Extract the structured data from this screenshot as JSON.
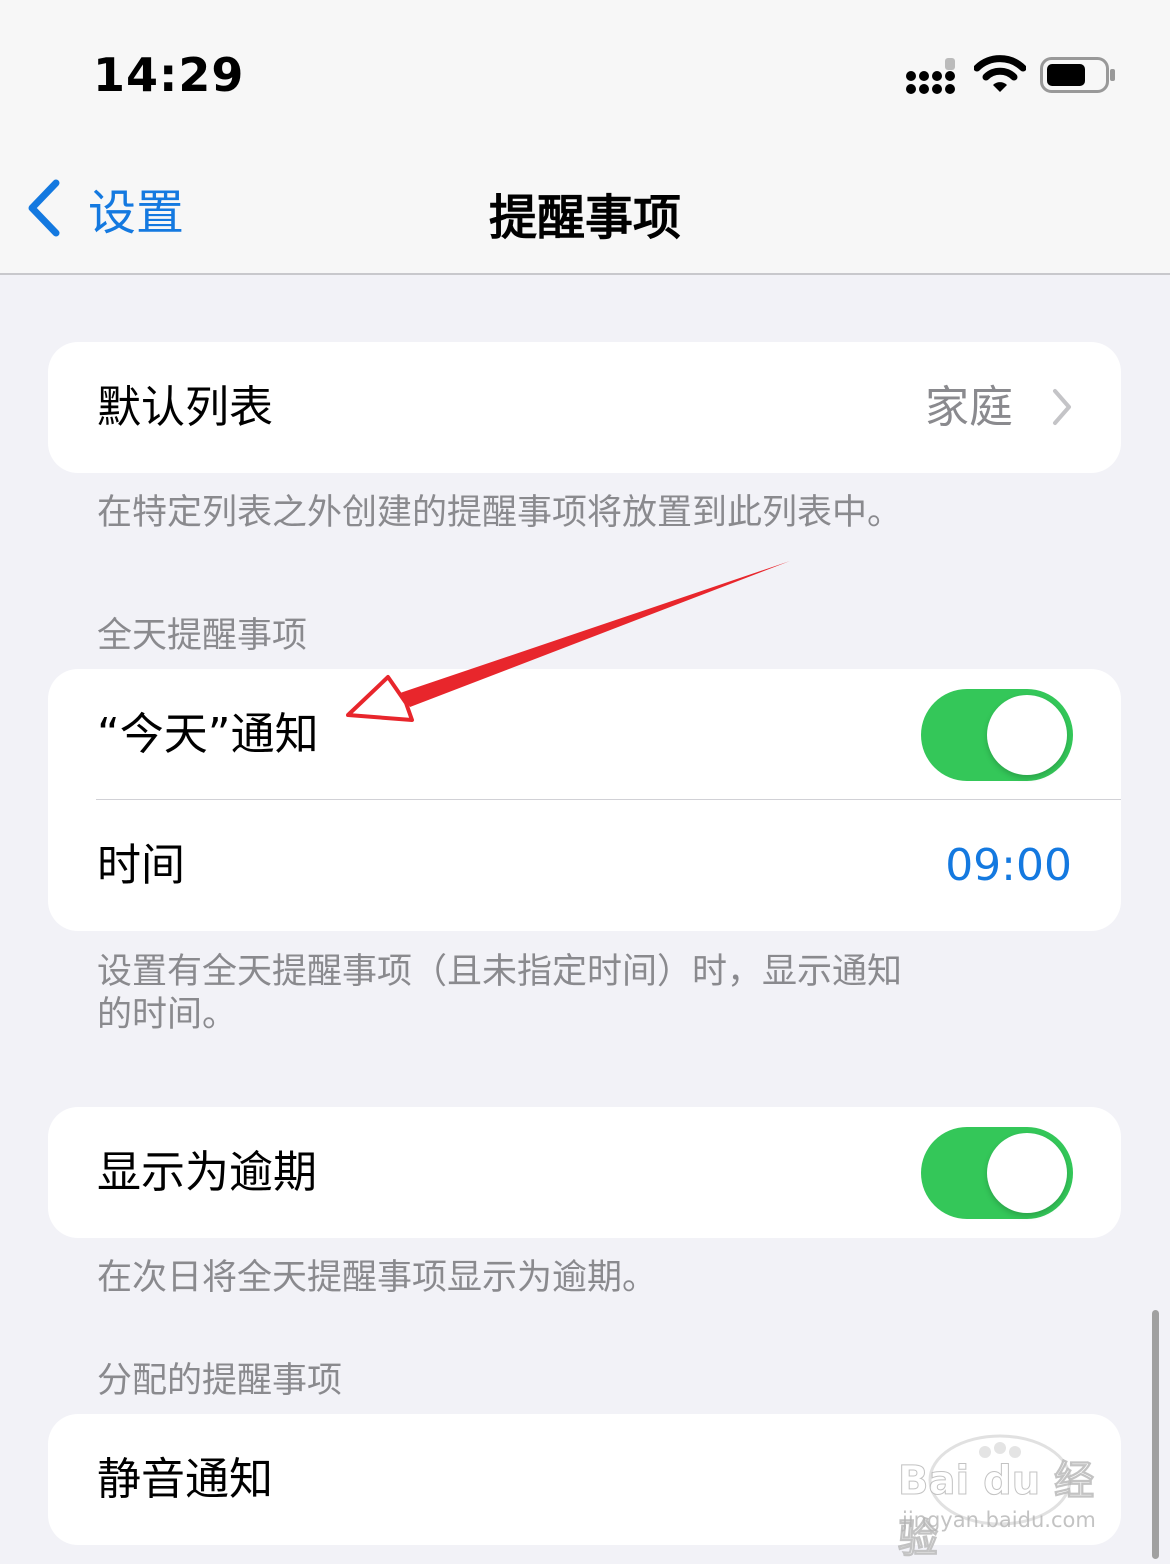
{
  "status_bar": {
    "time": "14:29",
    "icons": [
      "cellular-signal-icon",
      "wifi-icon",
      "battery-icon"
    ]
  },
  "nav": {
    "back_label": "设置",
    "title": "提醒事项",
    "accent": "#1479e0"
  },
  "default_list": {
    "label": "默认列表",
    "value": "家庭",
    "footer": "在特定列表之外创建的提醒事项将放置到此列表中。"
  },
  "all_day": {
    "header": "全天提醒事项",
    "today_label": "“今天”通知",
    "today_on": true,
    "time_label": "时间",
    "time_value": "09:00",
    "footer_line1": "设置有全天提醒事项（且未指定时间）时，显示通知",
    "footer_line2": "的时间。"
  },
  "overdue": {
    "label": "显示为逾期",
    "on": true,
    "footer": "在次日将全天提醒事项显示为逾期。"
  },
  "assigned": {
    "header": "分配的提醒事项",
    "mute_label": "静音通知"
  },
  "colors": {
    "toggle_on": "#34c759",
    "annotation_arrow": "#e8262c",
    "background": "#f2f2f7"
  },
  "watermark": {
    "brand": "Bai du 经验",
    "url": "jingyan.baidu.com"
  }
}
